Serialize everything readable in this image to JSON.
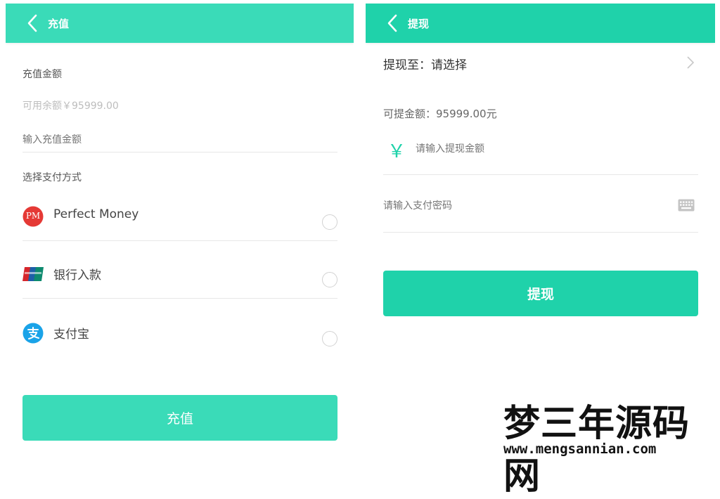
{
  "recharge": {
    "title": "充值",
    "amount_label": "充值金额",
    "balance_text": "可用余额￥95999.00",
    "amount_placeholder": "输入充值金额",
    "payment_method_label": "选择支付方式",
    "payment_methods": [
      {
        "name": "Perfect Money",
        "icon": "perfect-money-icon",
        "icon_text": "PM"
      },
      {
        "name": "银行入款",
        "icon": "unionpay-icon"
      },
      {
        "name": "支付宝",
        "icon": "alipay-icon"
      }
    ],
    "submit_label": "充值"
  },
  "withdraw": {
    "title": "提现",
    "destination_label": "提现至：请选择",
    "available_text": "可提金额：95999.00元",
    "currency_symbol": "￥",
    "amount_placeholder": "请输入提现金额",
    "password_placeholder": "请输入支付密码",
    "submit_label": "提现"
  },
  "watermark": {
    "title": "梦三年源码网",
    "url": "www.mengsannian.com"
  },
  "colors": {
    "recharge_accent": "#3adbb8",
    "withdraw_accent": "#1fd2aa",
    "perfect_money_red": "#e53935",
    "alipay_blue": "#1aa3e8"
  }
}
